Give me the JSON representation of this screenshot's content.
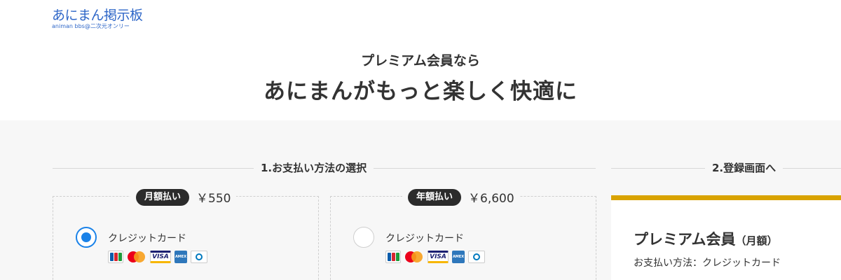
{
  "header": {
    "logo_main": "あにまん掲示板",
    "logo_sub": "animan bbs@二次元オンリー"
  },
  "hero": {
    "subtitle": "プレミアム会員なら",
    "title": "あにまんがもっと楽しく快適に"
  },
  "steps": {
    "step1": "1.お支払い方法の選択",
    "step2": "2.登録画面へ"
  },
  "plans": [
    {
      "badge": "月額払い",
      "price": "￥550",
      "method": "クレジットカード",
      "selected": true
    },
    {
      "badge": "年額払い",
      "price": "￥6,600",
      "method": "クレジットカード",
      "selected": false
    }
  ],
  "card_brands": [
    "JCB",
    "Mastercard",
    "VISA",
    "AMERICAN EXPRESS",
    "Diners Club"
  ],
  "registration": {
    "title": "プレミアム会員",
    "title_suffix": "（月額）",
    "method_line": "お支払い方法：クレジットカード"
  },
  "colors": {
    "accent_blue": "#1a82e8",
    "logo_blue": "#2f67c8",
    "panel_gold": "#d9a300",
    "pill_dark": "#2b2b2b"
  }
}
